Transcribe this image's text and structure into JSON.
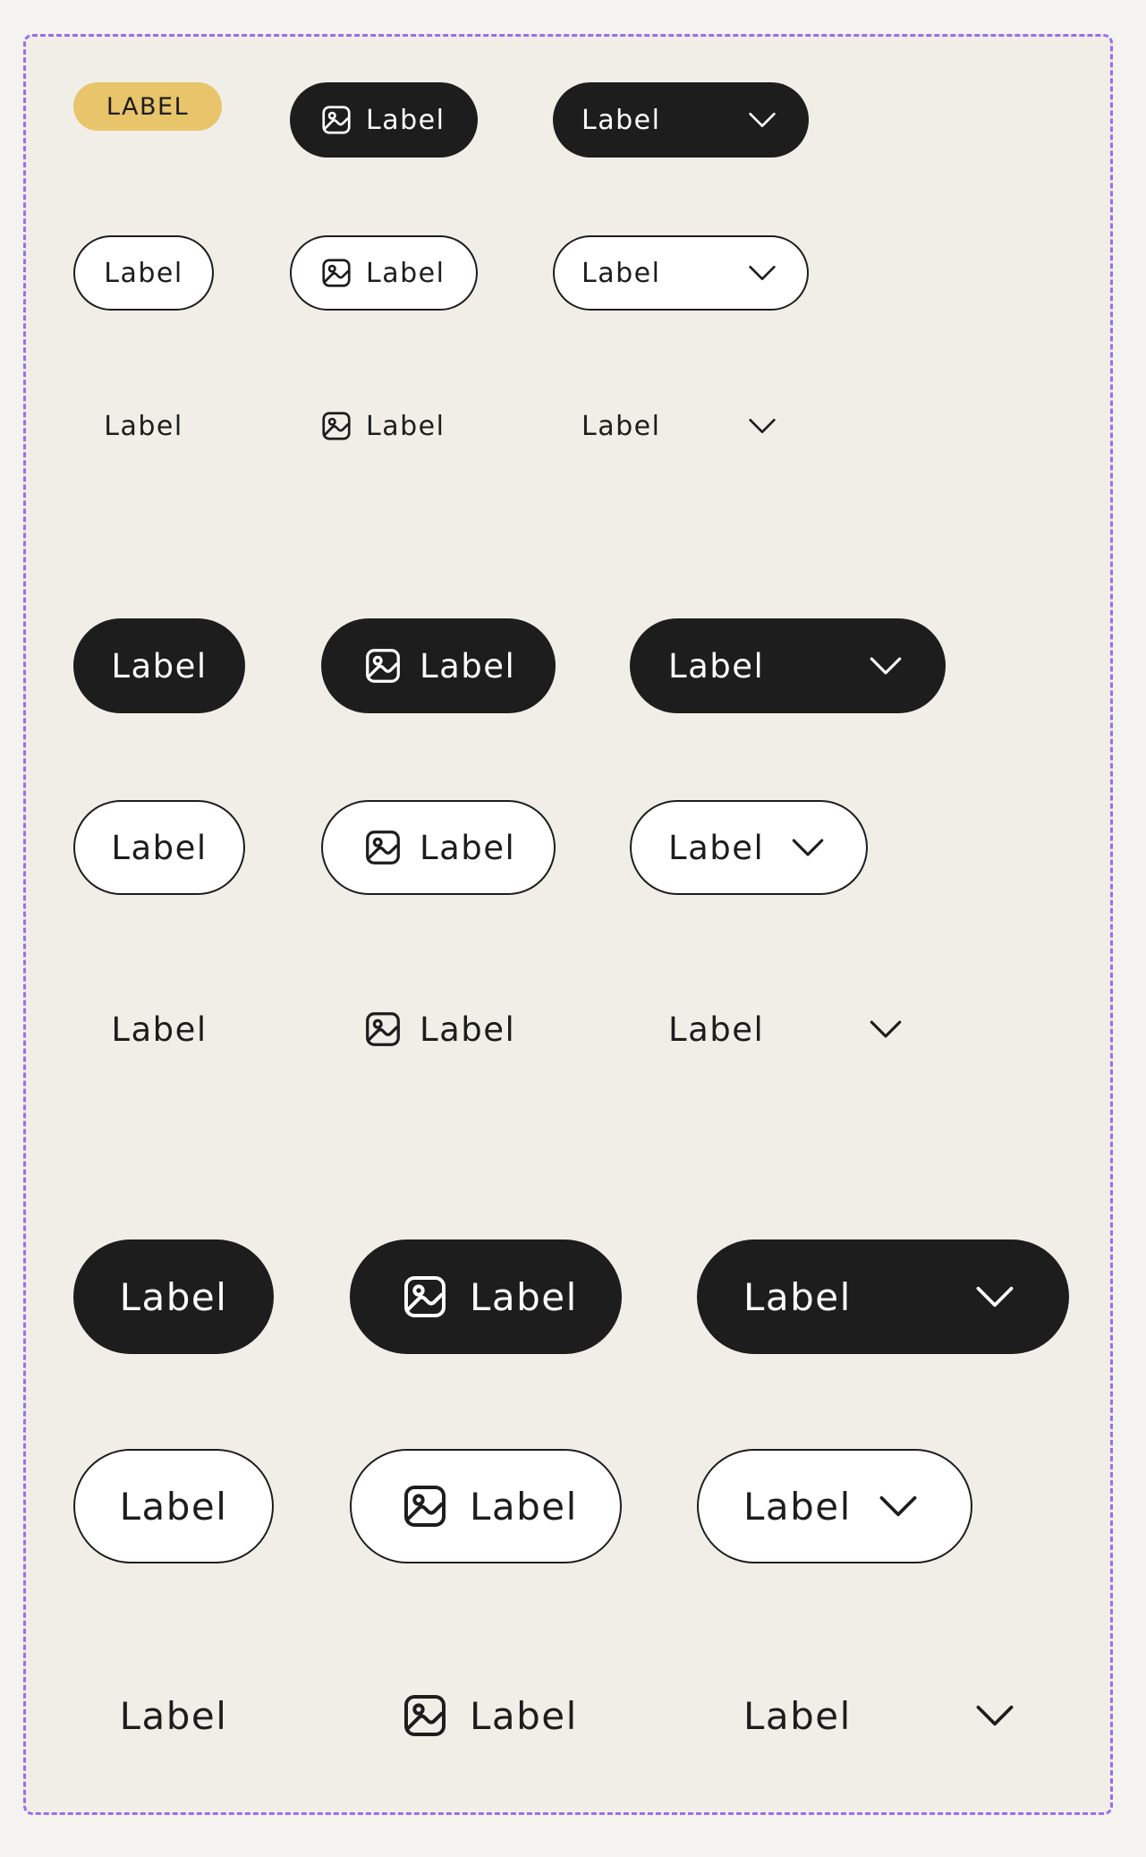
{
  "badge": {
    "label": "LABEL",
    "color": "#e8c46b"
  },
  "buttons": {
    "label": "Label",
    "icon_name": "image-icon",
    "trailing_icon_name": "chevron-down-icon"
  },
  "colors": {
    "dark": "#1d1d1d",
    "light": "#ffffff",
    "canvas": "#f1eee7",
    "frame_border": "#9a6ef2"
  }
}
